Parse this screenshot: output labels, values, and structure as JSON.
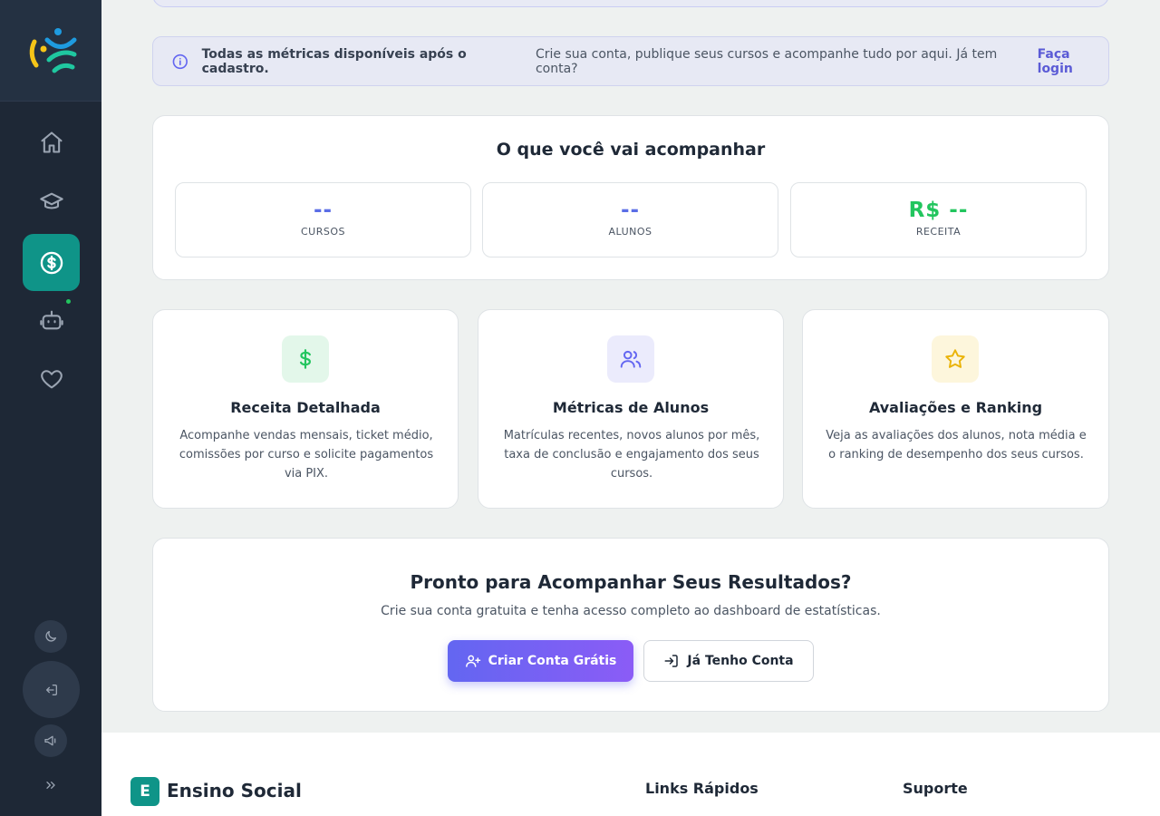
{
  "sidebar": {
    "logo": "logo-icon",
    "items": [
      {
        "name": "home",
        "icon": "home-icon"
      },
      {
        "name": "courses",
        "icon": "graduation-cap-icon"
      },
      {
        "name": "finance",
        "icon": "dollar-circle-icon",
        "active": true
      },
      {
        "name": "bot",
        "icon": "bot-icon"
      },
      {
        "name": "favorites",
        "icon": "heart-icon"
      }
    ],
    "bottom": [
      "moon-icon",
      "logout-icon",
      "megaphone-icon",
      "chevrons-right-icon"
    ],
    "active_color": "#0f9488"
  },
  "banner": {
    "bold": "Todas as métricas disponíveis após o cadastro.",
    "text": "Crie sua conta, publique seus cursos e acompanhe tudo por aqui. Já tem conta?",
    "link": "Faça login"
  },
  "tracking": {
    "title": "O que você vai acompanhar",
    "metrics": [
      {
        "value": "--",
        "label": "CURSOS"
      },
      {
        "value": "--",
        "label": "ALUNOS"
      },
      {
        "value": "R$ --",
        "label": "RECEITA"
      }
    ]
  },
  "features": [
    {
      "title": "Receita Detalhada",
      "desc": "Acompanhe vendas mensais, ticket médio, comissões por curso e solicite pagamentos via PIX.",
      "icon": "dollar-icon",
      "color": "#22c55e"
    },
    {
      "title": "Métricas de Alunos",
      "desc": "Matrículas recentes, novos alunos por mês, taxa de conclusão e engajamento dos seus cursos.",
      "icon": "users-icon",
      "color": "#6366f1"
    },
    {
      "title": "Avaliações e Ranking",
      "desc": "Veja as avaliações dos alunos, nota média e o ranking de desempenho dos seus cursos.",
      "icon": "star-icon",
      "color": "#eab308"
    }
  ],
  "cta": {
    "title": "Pronto para Acompanhar Seus Resultados?",
    "subtitle": "Crie sua conta gratuita e tenha acesso completo ao dashboard de estatísticas.",
    "primary": "Criar Conta Grátis",
    "secondary": "Já Tenho Conta"
  },
  "footer": {
    "brand_letter": "E",
    "brand": "Ensino Social",
    "col1": "Links Rápidos",
    "col2": "Suporte"
  }
}
